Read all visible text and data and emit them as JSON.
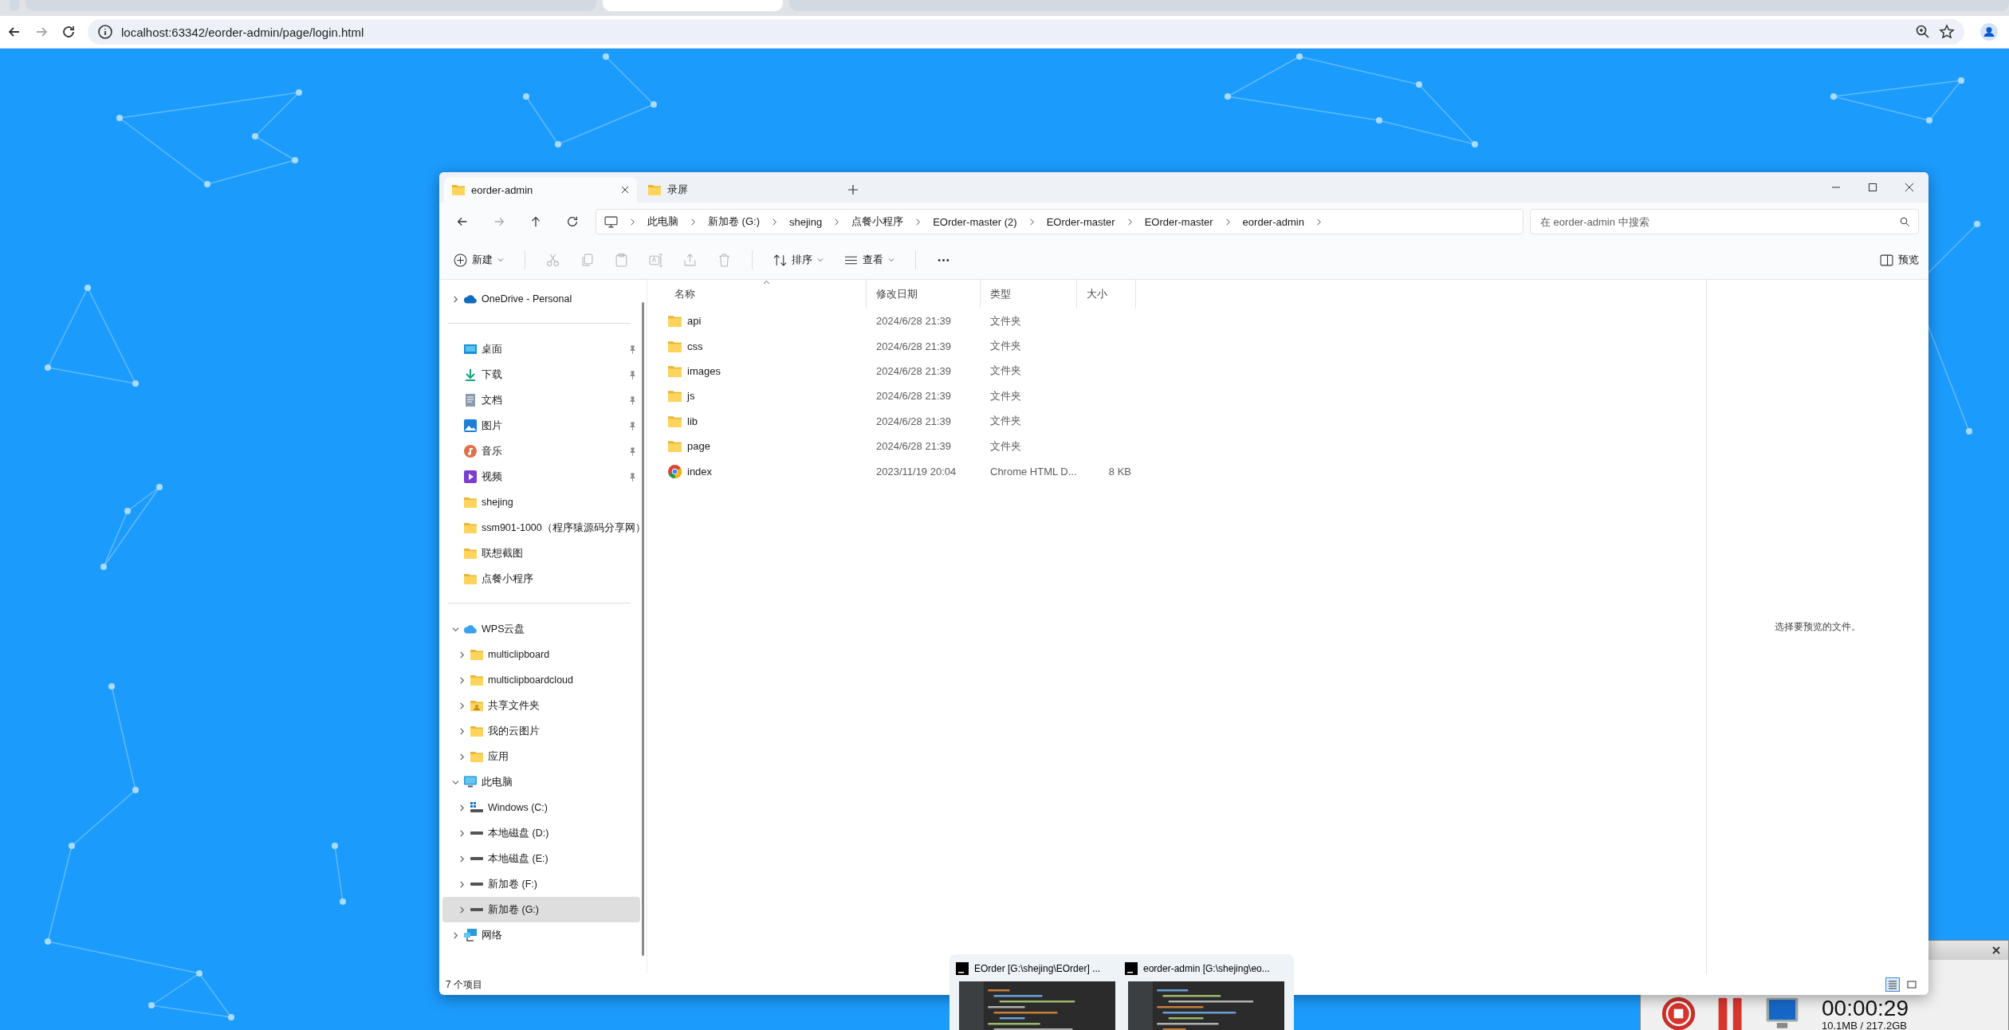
{
  "browser": {
    "tabs": [
      {
        "selected": false
      },
      {
        "selected": false
      },
      {
        "selected": true
      },
      {
        "selected": false
      }
    ],
    "url": "localhost:63342/eorder-admin/page/login.html"
  },
  "explorer": {
    "tabs": [
      {
        "label": "eorder-admin",
        "selected": true
      },
      {
        "label": "录屏",
        "selected": false
      }
    ],
    "breadcrumb": [
      "此电脑",
      "新加卷 (G:)",
      "shejing",
      "点餐小程序",
      "EOrder-master (2)",
      "EOrder-master",
      "EOrder-master",
      "eorder-admin"
    ],
    "search": {
      "placeholder": "在 eorder-admin 中搜索"
    },
    "toolbar": [
      {
        "kind": "new",
        "label": "新建",
        "disabled": false
      },
      {
        "kind": "cut",
        "disabled": true
      },
      {
        "kind": "copy",
        "disabled": true
      },
      {
        "kind": "paste",
        "disabled": true
      },
      {
        "kind": "rename",
        "disabled": true
      },
      {
        "kind": "share",
        "disabled": true
      },
      {
        "kind": "delete",
        "disabled": true
      },
      {
        "kind": "sort",
        "label": "排序",
        "disabled": false
      },
      {
        "kind": "view",
        "label": "查看",
        "disabled": false
      },
      {
        "kind": "more",
        "disabled": false
      }
    ],
    "preview_button": "预览",
    "sidebar": [
      [
        {
          "label": "OneDrive - Personal",
          "kind": "cloud",
          "expanded": false,
          "selected": false
        }
      ],
      [
        {
          "label": "桌面",
          "kind": "desktop",
          "pinned": true,
          "selected": false
        },
        {
          "label": "下载",
          "kind": "download",
          "pinned": true,
          "selected": false
        },
        {
          "label": "文档",
          "kind": "document",
          "pinned": true,
          "selected": false
        },
        {
          "label": "图片",
          "kind": "pictures",
          "pinned": true,
          "selected": false
        },
        {
          "label": "音乐",
          "kind": "music",
          "pinned": true,
          "selected": false
        },
        {
          "label": "视频",
          "kind": "video",
          "pinned": true,
          "selected": false
        },
        {
          "label": "shejing",
          "kind": "folder",
          "pinned": false,
          "selected": false
        },
        {
          "label": "ssm901-1000（程序猿源码分享网）",
          "kind": "folder",
          "pinned": false,
          "selected": false
        },
        {
          "label": "联想截图",
          "kind": "folder",
          "pinned": false,
          "selected": false
        },
        {
          "label": "点餐小程序",
          "kind": "folder",
          "pinned": false,
          "selected": false
        }
      ],
      [
        {
          "label": "WPS云盘",
          "kind": "wps-cloud",
          "expanded": true,
          "selected": false,
          "children": [
            {
              "label": "multiclipboard",
              "kind": "folder",
              "expanded": false,
              "selected": false
            },
            {
              "label": "multiclipboardcloud",
              "kind": "folder",
              "expanded": false,
              "selected": false
            },
            {
              "label": "共享文件夹",
              "kind": "shared-folder",
              "expanded": false,
              "selected": false
            },
            {
              "label": "我的云图片",
              "kind": "folder",
              "expanded": false,
              "selected": false
            },
            {
              "label": "应用",
              "kind": "folder",
              "expanded": false,
              "selected": false
            }
          ]
        },
        {
          "label": "此电脑",
          "kind": "pc",
          "expanded": true,
          "selected": false,
          "children": [
            {
              "label": "Windows (C:)",
              "kind": "windows-drive",
              "expanded": false,
              "selected": false
            },
            {
              "label": "本地磁盘 (D:)",
              "kind": "drive",
              "expanded": false,
              "selected": false
            },
            {
              "label": "本地磁盘 (E:)",
              "kind": "drive",
              "expanded": false,
              "selected": false
            },
            {
              "label": "新加卷 (F:)",
              "kind": "drive",
              "expanded": false,
              "selected": false
            },
            {
              "label": "新加卷 (G:)",
              "kind": "drive",
              "expanded": false,
              "selected": true
            }
          ]
        },
        {
          "label": "网络",
          "kind": "network",
          "expanded": false,
          "selected": false
        }
      ]
    ],
    "columns": [
      "名称",
      "修改日期",
      "类型",
      "大小"
    ],
    "files": [
      {
        "kind": "folder",
        "name": "api",
        "date": "2024/6/28 21:39",
        "type": "文件夹"
      },
      {
        "kind": "folder",
        "name": "css",
        "date": "2024/6/28 21:39",
        "type": "文件夹"
      },
      {
        "kind": "folder",
        "name": "images",
        "date": "2024/6/28 21:39",
        "type": "文件夹"
      },
      {
        "kind": "folder",
        "name": "js",
        "date": "2024/6/28 21:39",
        "type": "文件夹"
      },
      {
        "kind": "folder",
        "name": "lib",
        "date": "2024/6/28 21:39",
        "type": "文件夹"
      },
      {
        "kind": "folder",
        "name": "page",
        "date": "2024/6/28 21:39",
        "type": "文件夹"
      },
      {
        "kind": "html",
        "name": "index",
        "date": "2023/11/19 20:04",
        "type": "Chrome HTML D...",
        "size": "8 KB"
      }
    ],
    "preview_hint": "选择要预览的文件。",
    "status": "7 个项目"
  },
  "taskbar_previews": [
    {
      "title": "EOrder [G:\\shejing\\EOrder] ..."
    },
    {
      "title": "eorder-admin [G:\\shejing\\eo..."
    }
  ],
  "recorder": {
    "time": "00:00:29",
    "storage": "10.1MB / 217.2GB"
  }
}
